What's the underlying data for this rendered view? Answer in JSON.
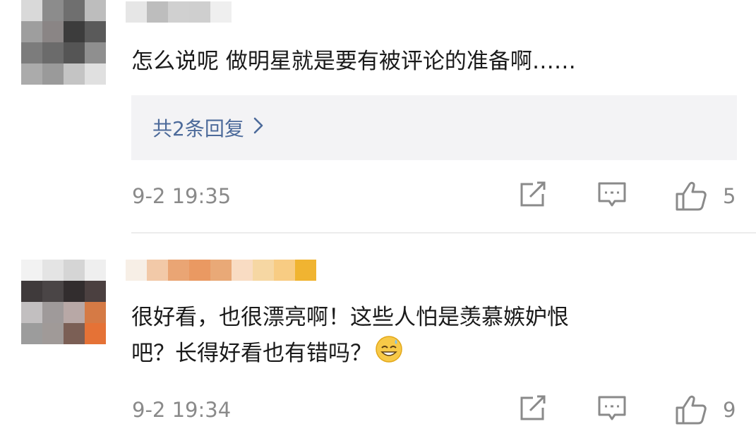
{
  "comments": [
    {
      "text": "怎么说呢 做明星就是要有被评论的准备啊……",
      "replies_label": "共2条回复",
      "timestamp": "9-2 19:35",
      "likes": "5"
    },
    {
      "text_line1": "很好看，也很漂亮啊！这些人怕是羡慕嫉妒恨",
      "text_line2": "吧？长得好看也有错吗？",
      "emoji": "grinning-sweat-emoji",
      "timestamp": "9-2 19:34",
      "likes": "9"
    }
  ],
  "colors": {
    "reply_link": "#4c6a9a",
    "reply_bg": "#f3f3f5",
    "meta_text": "#8a8a8a"
  },
  "icons": [
    "edit-repost-icon",
    "comment-bubble-icon",
    "thumbs-up-icon",
    "chevron-right-icon"
  ]
}
